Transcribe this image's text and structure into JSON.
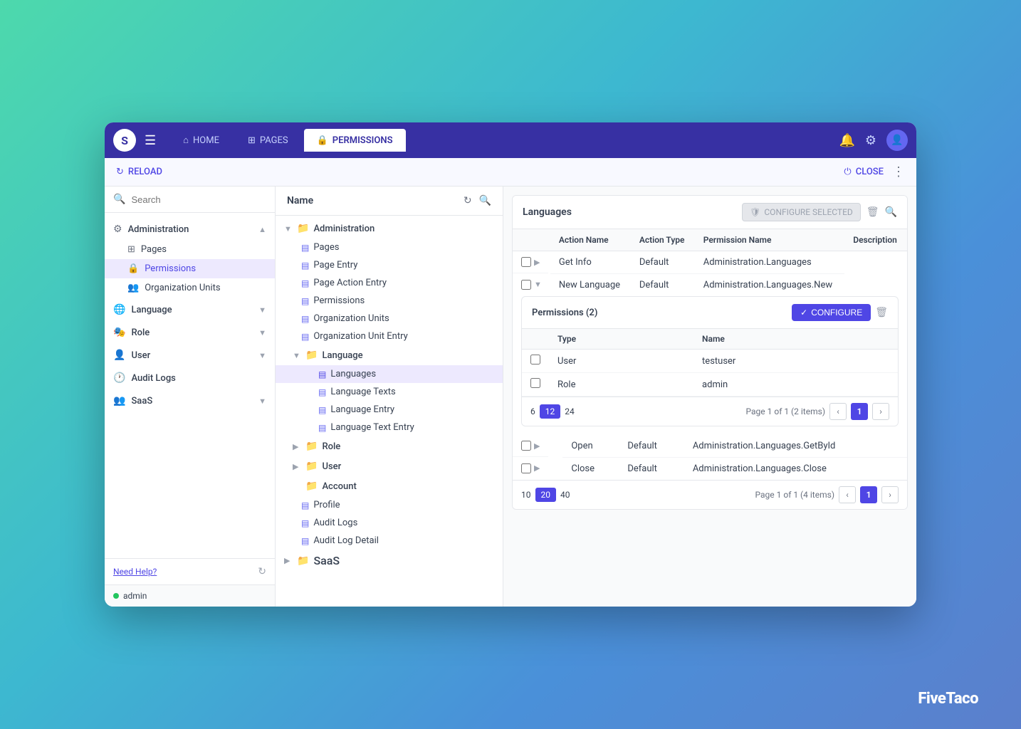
{
  "app": {
    "logo_letter": "S",
    "branding": "FiveTaco"
  },
  "top_nav": {
    "tabs": [
      {
        "id": "home",
        "label": "HOME",
        "icon": "⌂",
        "active": false
      },
      {
        "id": "pages",
        "label": "PAGES",
        "icon": "⊞",
        "active": false
      },
      {
        "id": "permissions",
        "label": "PERMISSIONS",
        "icon": "🔒",
        "active": true
      }
    ],
    "reload_label": "RELOAD",
    "close_label": "CLOSE"
  },
  "sidebar": {
    "search_placeholder": "Search",
    "groups": [
      {
        "id": "administration",
        "label": "Administration",
        "icon": "⚙",
        "expanded": true,
        "items": [
          {
            "id": "pages",
            "label": "Pages",
            "icon": "⊞",
            "active": false
          },
          {
            "id": "permissions",
            "label": "Permissions",
            "icon": "🔒",
            "active": true
          },
          {
            "id": "org-units",
            "label": "Organization Units",
            "icon": "👥",
            "active": false
          }
        ]
      },
      {
        "id": "language",
        "label": "Language",
        "icon": "🌐",
        "expanded": false,
        "items": []
      },
      {
        "id": "role",
        "label": "Role",
        "icon": "🎭",
        "expanded": false,
        "items": []
      },
      {
        "id": "user",
        "label": "User",
        "icon": "👤",
        "expanded": false,
        "items": []
      },
      {
        "id": "audit-logs",
        "label": "Audit Logs",
        "icon": "🕐",
        "expanded": false,
        "items": []
      }
    ],
    "saas_label": "SaaS",
    "need_help": "Need Help?",
    "user_name": "admin"
  },
  "tree": {
    "header_label": "Name",
    "nodes": [
      {
        "id": "administration",
        "label": "Administration",
        "expanded": true,
        "type": "folder",
        "children": [
          {
            "id": "pages",
            "label": "Pages",
            "type": "leaf"
          },
          {
            "id": "page-entry",
            "label": "Page Entry",
            "type": "leaf"
          },
          {
            "id": "page-action-entry",
            "label": "Page Action Entry",
            "type": "leaf"
          },
          {
            "id": "permissions",
            "label": "Permissions",
            "type": "leaf"
          },
          {
            "id": "org-units",
            "label": "Organization Units",
            "type": "leaf"
          },
          {
            "id": "org-unit-entry",
            "label": "Organization Unit Entry",
            "type": "leaf"
          },
          {
            "id": "language",
            "label": "Language",
            "type": "folder",
            "expanded": true,
            "children": [
              {
                "id": "languages",
                "label": "Languages",
                "type": "leaf",
                "active": true
              },
              {
                "id": "language-texts",
                "label": "Language Texts",
                "type": "leaf"
              },
              {
                "id": "language-entry",
                "label": "Language Entry",
                "type": "leaf"
              },
              {
                "id": "language-text-entry",
                "label": "Language Text Entry",
                "type": "leaf"
              }
            ]
          },
          {
            "id": "role-folder",
            "label": "Role",
            "type": "folder",
            "expanded": false
          },
          {
            "id": "user-folder",
            "label": "User",
            "type": "folder",
            "expanded": false
          },
          {
            "id": "account",
            "label": "Account",
            "type": "folder-leaf"
          },
          {
            "id": "profile",
            "label": "Profile",
            "type": "leaf"
          },
          {
            "id": "audit-logs",
            "label": "Audit Logs",
            "type": "leaf"
          },
          {
            "id": "audit-log-detail",
            "label": "Audit Log Detail",
            "type": "leaf"
          }
        ]
      },
      {
        "id": "saas",
        "label": "SaaS",
        "type": "folder",
        "expanded": false
      }
    ]
  },
  "content": {
    "section_title": "Languages",
    "configure_selected_label": "CONFIGURE SELECTED",
    "table_headers": [
      "",
      "Action Name",
      "Action Type",
      "Permission Name",
      "Description"
    ],
    "rows": [
      {
        "id": 1,
        "expand": false,
        "action_name": "Get Info",
        "action_type": "Default",
        "permission_name": "Administration.Languages",
        "description": ""
      },
      {
        "id": 2,
        "expand": true,
        "action_name": "New Language",
        "action_type": "Default",
        "permission_name": "Administration.Languages.New",
        "description": ""
      },
      {
        "id": 3,
        "expand": false,
        "action_name": "Open",
        "action_type": "Default",
        "permission_name": "Administration.Languages.GetById",
        "description": ""
      },
      {
        "id": 4,
        "expand": false,
        "action_name": "Close",
        "action_type": "Default",
        "permission_name": "Administration.Languages.Close",
        "description": ""
      }
    ],
    "permissions_sub": {
      "title": "Permissions (2)",
      "configure_label": "CONFIGURE",
      "sub_headers": [
        "",
        "Type",
        "Name"
      ],
      "sub_rows": [
        {
          "id": 1,
          "type": "User",
          "name": "testuser"
        },
        {
          "id": 2,
          "type": "Role",
          "name": "admin"
        }
      ],
      "pagination": {
        "sizes": [
          "6",
          "12",
          "24"
        ],
        "active_size": "12",
        "page_info": "Page 1 of 1 (2 items)",
        "current_page": "1"
      }
    },
    "pagination": {
      "sizes": [
        "10",
        "20",
        "40"
      ],
      "active_size": "20",
      "page_info": "Page 1 of 1 (4 items)",
      "current_page": "1"
    }
  }
}
